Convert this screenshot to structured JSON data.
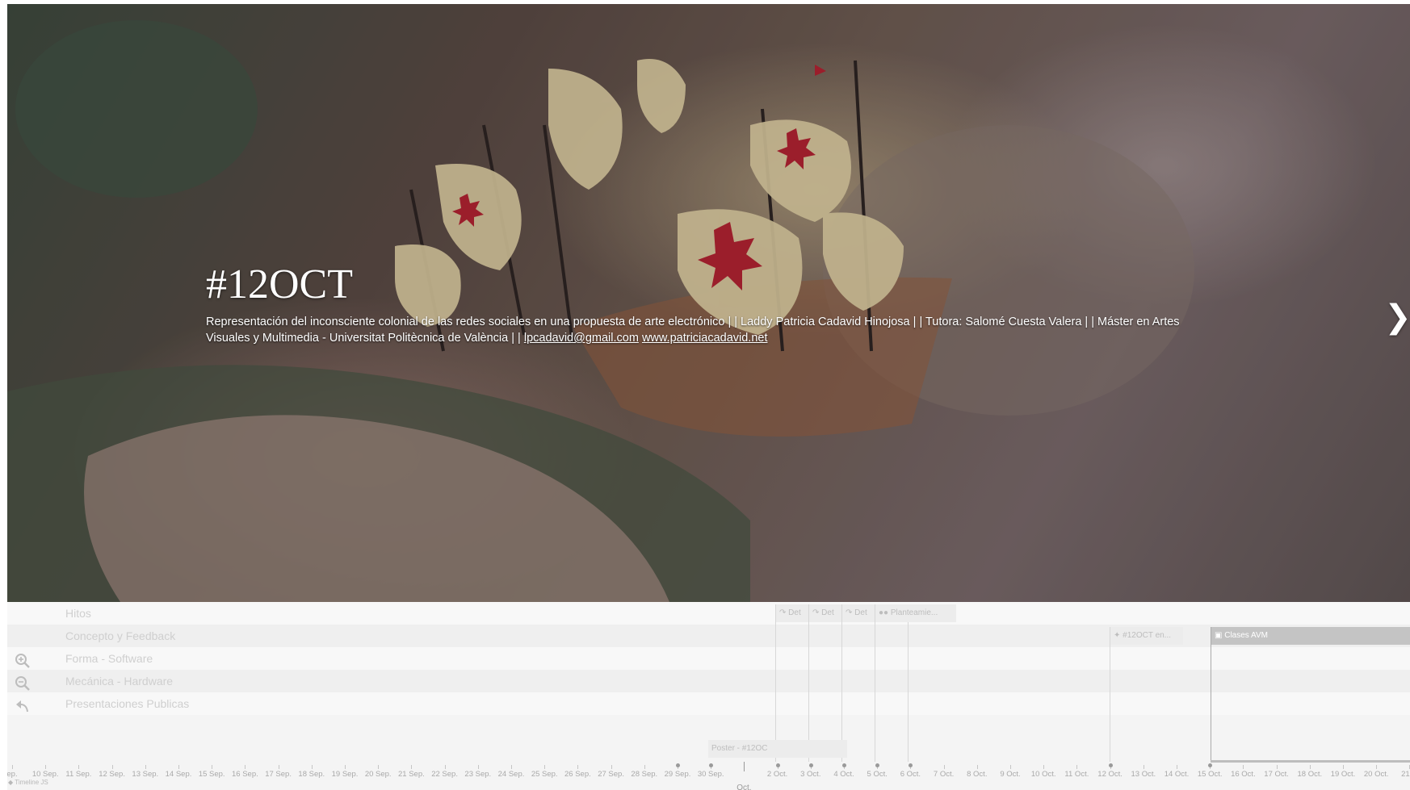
{
  "slide": {
    "title": "#12OCT",
    "description": "Representación del inconsciente colonial de las redes sociales en una propuesta de arte electrónico | | Laddy Patricia Cadavid Hinojosa | | Tutora: Salomé Cuesta Valera | | Máster en Artes Visuales y Multimedia - Universitat Politècnica de València | | ",
    "email": "lpcadavid@gmail.com",
    "website": "www.patriciacadavid.net",
    "next_arrow": "❯"
  },
  "timeline": {
    "groups": [
      "Hitos",
      "Concepto y Feedback",
      "Forma - Software",
      "Mecánica - Hardware",
      "Presentaciones Publicas"
    ],
    "markers": [
      {
        "label": "Det",
        "icon": "link-icon"
      },
      {
        "label": "Det",
        "icon": "link-icon"
      },
      {
        "label": "Det",
        "icon": "link-icon"
      },
      {
        "label": "Planteamie...",
        "icon": "flickr-icon"
      },
      {
        "label": "#12OCT en...",
        "icon": "twitter-icon"
      },
      {
        "label": "Clases AVM",
        "icon": "image-icon"
      },
      {
        "label": "Poster - #12OC",
        "icon": "none"
      }
    ],
    "axis_labels": [
      "ep.",
      "10 Sep.",
      "11 Sep.",
      "12 Sep.",
      "13 Sep.",
      "14 Sep.",
      "15 Sep.",
      "16 Sep.",
      "17 Sep.",
      "18 Sep.",
      "19 Sep.",
      "20 Sep.",
      "21 Sep.",
      "22 Sep.",
      "23 Sep.",
      "24 Sep.",
      "25 Sep.",
      "26 Sep.",
      "27 Sep.",
      "28 Sep.",
      "29 Sep.",
      "30 Sep.",
      "",
      "2 Oct.",
      "3 Oct.",
      "4 Oct.",
      "5 Oct.",
      "6 Oct.",
      "7 Oct.",
      "8 Oct.",
      "9 Oct.",
      "10 Oct.",
      "11 Oct.",
      "12 Oct.",
      "13 Oct.",
      "14 Oct.",
      "15 Oct.",
      "16 Oct.",
      "17 Oct.",
      "18 Oct.",
      "19 Oct.",
      "20 Oct.",
      "21 O"
    ],
    "month_label": "Oct.",
    "credit": "Timeline JS"
  }
}
